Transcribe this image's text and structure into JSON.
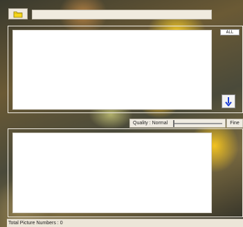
{
  "toolbar": {
    "folder_icon": "folder-icon",
    "path_value": ""
  },
  "top_panel": {
    "all_label": "ALL",
    "down_icon": "arrow-down-icon"
  },
  "quality": {
    "label": "Quality : Normal",
    "level": 0.0,
    "max_label": "Fine"
  },
  "status": {
    "text": "Total Picture Numbers : 0"
  },
  "colors": {
    "folder_yellow": "#f5d51a",
    "arrow_blue": "#1c3fd6"
  }
}
